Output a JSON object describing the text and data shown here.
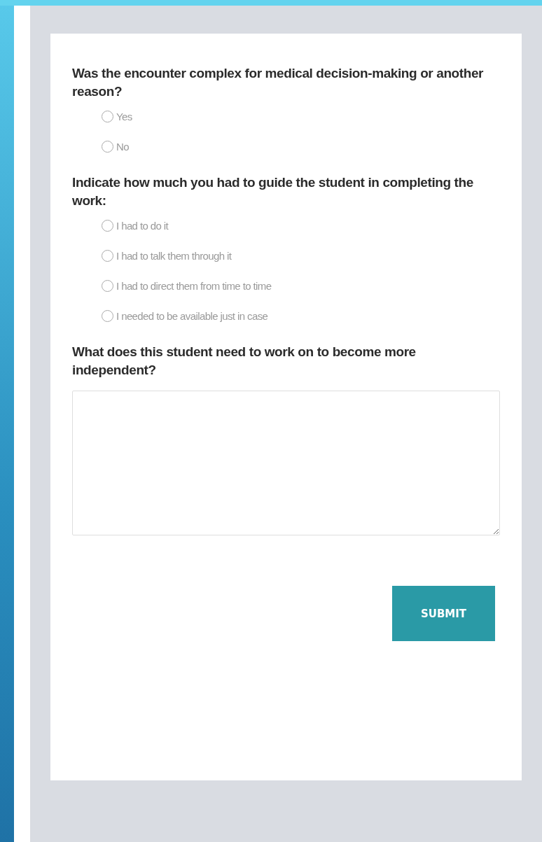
{
  "questions": [
    {
      "kind": "radio",
      "label": "Was the encounter complex for medical decision-making or another reason?",
      "options": [
        {
          "label": "Yes",
          "selected": false
        },
        {
          "label": "No",
          "selected": false
        }
      ]
    },
    {
      "kind": "radio",
      "label": "Indicate how much you had to guide the student in completing the work:",
      "options": [
        {
          "label": "I had to do it",
          "selected": false
        },
        {
          "label": "I had to talk them through it",
          "selected": false
        },
        {
          "label": "I had to direct them from time to time",
          "selected": false
        },
        {
          "label": "I needed to be available just in case",
          "selected": false
        }
      ]
    },
    {
      "kind": "text",
      "label": "What does this student need to work on to become more independent?"
    }
  ],
  "submit": {
    "label": "SUBMIT"
  }
}
